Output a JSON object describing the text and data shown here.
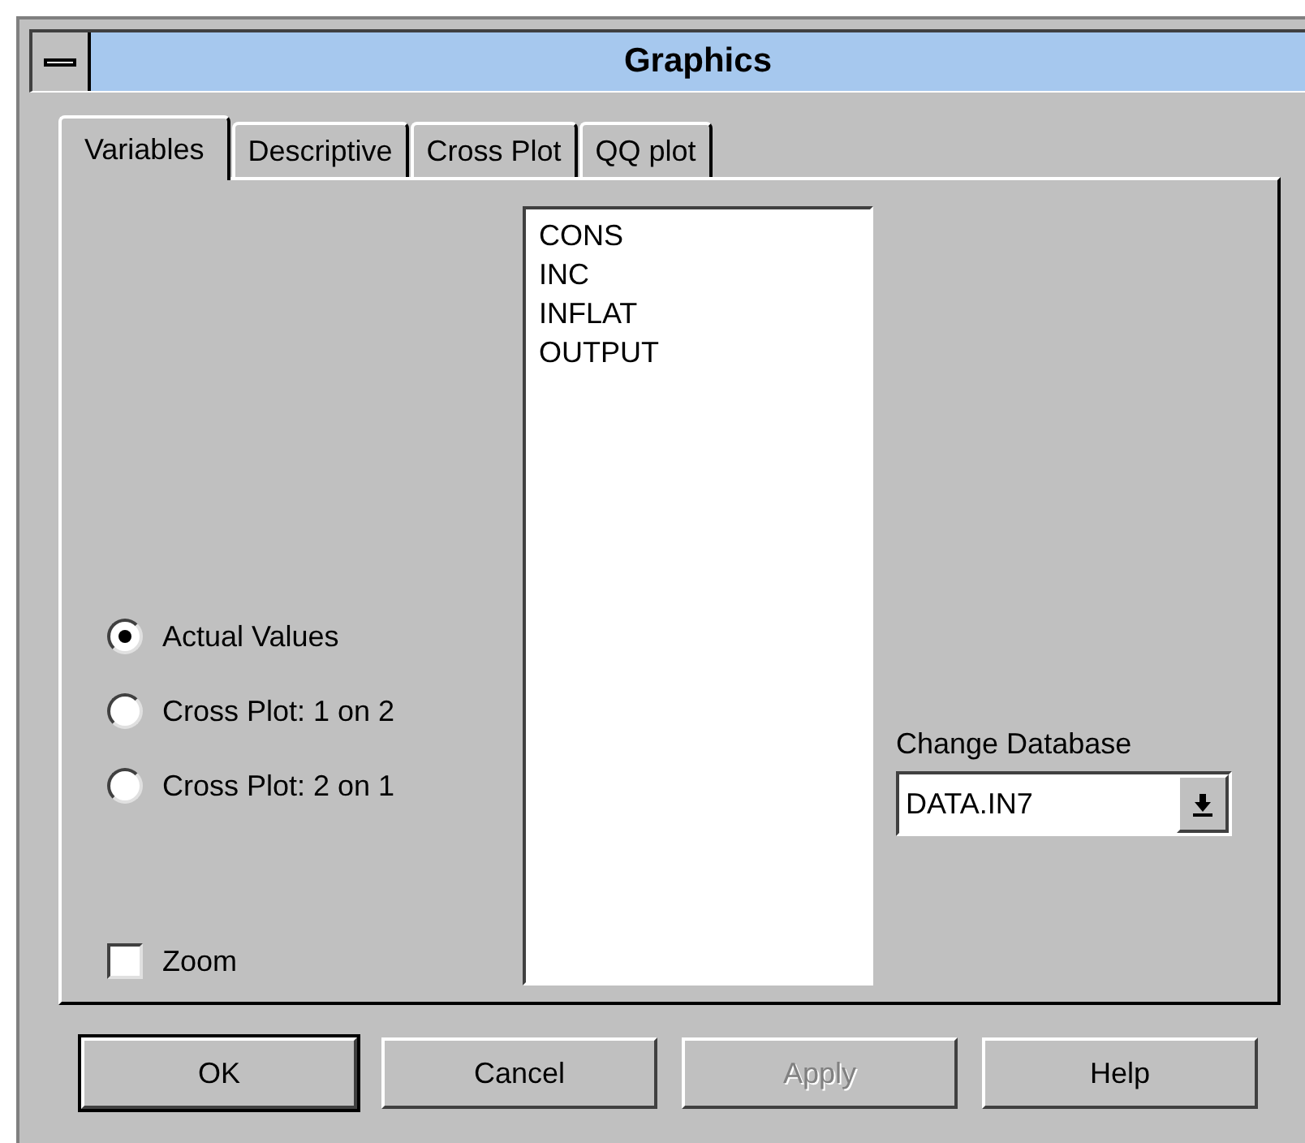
{
  "window": {
    "title": "Graphics"
  },
  "tabs": [
    {
      "label": "Variables",
      "selected": true
    },
    {
      "label": "Descriptive",
      "selected": false
    },
    {
      "label": "Cross Plot",
      "selected": false
    },
    {
      "label": "QQ plot",
      "selected": false
    }
  ],
  "plot_options": [
    {
      "label": "Actual Values",
      "selected": true
    },
    {
      "label": "Cross Plot: 1 on 2",
      "selected": false
    },
    {
      "label": "Cross Plot: 2 on 1",
      "selected": false
    }
  ],
  "zoom": {
    "label": "Zoom",
    "checked": false
  },
  "variables": [
    {
      "name": "CONS",
      "selected": false
    },
    {
      "name": "INC",
      "selected": false
    },
    {
      "name": "INFLAT",
      "selected": false
    },
    {
      "name": "OUTPUT",
      "selected": false
    }
  ],
  "database": {
    "label": "Change Database",
    "value": "DATA.IN7"
  },
  "buttons": [
    {
      "label": "OK",
      "default": true,
      "disabled": false
    },
    {
      "label": "Cancel",
      "default": false,
      "disabled": false
    },
    {
      "label": "Apply",
      "default": false,
      "disabled": true
    },
    {
      "label": "Help",
      "default": false,
      "disabled": false
    }
  ]
}
